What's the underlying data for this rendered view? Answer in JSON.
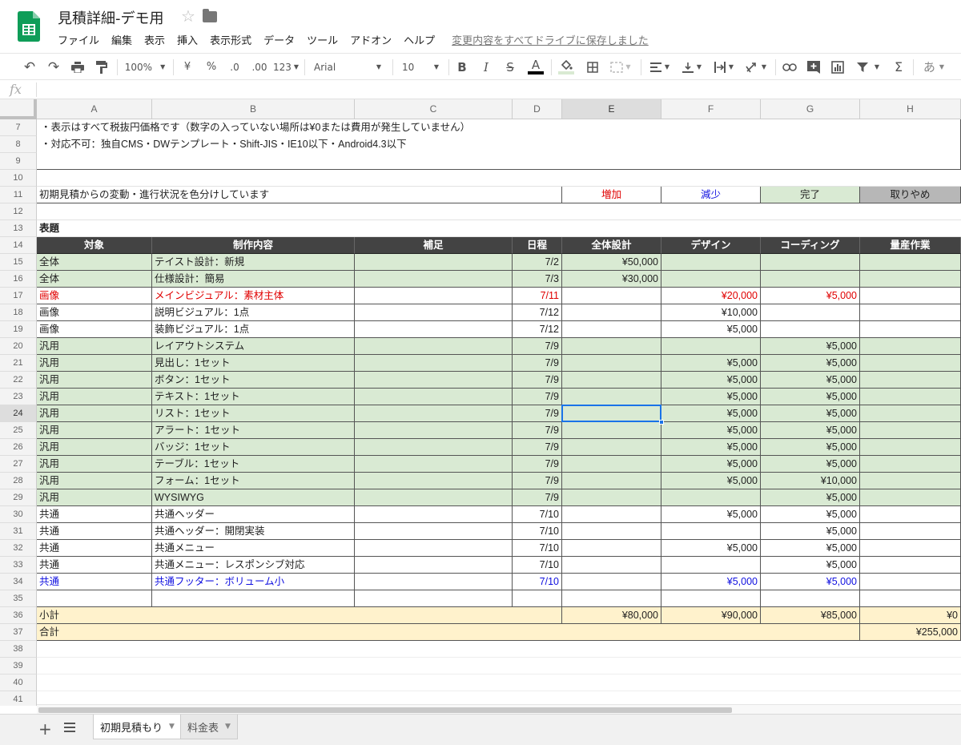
{
  "app": {
    "title": "見積詳細-デモ用",
    "menus": [
      "ファイル",
      "編集",
      "表示",
      "挿入",
      "表示形式",
      "データ",
      "ツール",
      "アドオン",
      "ヘルプ"
    ],
    "save_status": "変更内容をすべてドライブに保存しました"
  },
  "toolbar": {
    "zoom": "100%",
    "currency": "¥",
    "percent": "%",
    "dec_dec": ".0",
    "dec_inc": ".00",
    "format_more": "123",
    "font": "Arial",
    "font_size": "10",
    "bold": "B",
    "italic": "I",
    "strike": "S",
    "text_color": "A",
    "sum": "Σ",
    "input_tool": "あ"
  },
  "formula": {
    "fx": "fx",
    "value": ""
  },
  "columns": [
    "A",
    "B",
    "C",
    "D",
    "E",
    "F",
    "G",
    "H"
  ],
  "selected_col": "E",
  "selected_row": "24",
  "rows": [
    "7",
    "8",
    "9",
    "10",
    "11",
    "12",
    "13",
    "14",
    "15",
    "16",
    "17",
    "18",
    "19",
    "20",
    "21",
    "22",
    "23",
    "24",
    "25",
    "26",
    "27",
    "28",
    "29",
    "30",
    "31",
    "32",
    "33",
    "34",
    "35",
    "36",
    "37",
    "38",
    "39",
    "40",
    "41"
  ],
  "notes": [
    "・表示はすべて税抜円価格です（数字の入っていない場所は¥0または費用が発生していません）",
    "・対応不可：独自CMS・DWテンプレート・Shift-JIS・IE10以下・Android4.3以下"
  ],
  "legend": {
    "label": "初期見積からの変動・進行状況を色分けしています",
    "added": "増加",
    "reduced": "減少",
    "done": "完了",
    "cancelled": "取りやめ"
  },
  "section_title": "表題",
  "table_headers": [
    "対象",
    "制作内容",
    "補足",
    "日程",
    "全体設計",
    "デザイン",
    "コーディング",
    "量産作業"
  ],
  "table_rows": [
    {
      "a": "全体",
      "b": "テイスト設計：新規",
      "c": "",
      "d": "7/2",
      "e": "¥50,000",
      "f": "",
      "g": "",
      "h": "",
      "style": "green"
    },
    {
      "a": "全体",
      "b": "仕様設計：簡易",
      "c": "",
      "d": "7/3",
      "e": "¥30,000",
      "f": "",
      "g": "",
      "h": "",
      "style": "green"
    },
    {
      "a": "画像",
      "b": "メインビジュアル：素材主体",
      "c": "",
      "d": "7/11",
      "e": "",
      "f": "¥20,000",
      "g": "¥5,000",
      "h": "",
      "style": "red"
    },
    {
      "a": "画像",
      "b": "説明ビジュアル：1点",
      "c": "",
      "d": "7/12",
      "e": "",
      "f": "¥10,000",
      "g": "",
      "h": "",
      "style": ""
    },
    {
      "a": "画像",
      "b": "装飾ビジュアル：1点",
      "c": "",
      "d": "7/12",
      "e": "",
      "f": "¥5,000",
      "g": "",
      "h": "",
      "style": ""
    },
    {
      "a": "汎用",
      "b": "レイアウトシステム",
      "c": "",
      "d": "7/9",
      "e": "",
      "f": "",
      "g": "¥5,000",
      "h": "",
      "style": "green"
    },
    {
      "a": "汎用",
      "b": "見出し：1セット",
      "c": "",
      "d": "7/9",
      "e": "",
      "f": "¥5,000",
      "g": "¥5,000",
      "h": "",
      "style": "green"
    },
    {
      "a": "汎用",
      "b": "ボタン：1セット",
      "c": "",
      "d": "7/9",
      "e": "",
      "f": "¥5,000",
      "g": "¥5,000",
      "h": "",
      "style": "green"
    },
    {
      "a": "汎用",
      "b": "テキスト：1セット",
      "c": "",
      "d": "7/9",
      "e": "",
      "f": "¥5,000",
      "g": "¥5,000",
      "h": "",
      "style": "green"
    },
    {
      "a": "汎用",
      "b": "リスト：1セット",
      "c": "",
      "d": "7/9",
      "e": "",
      "f": "¥5,000",
      "g": "¥5,000",
      "h": "",
      "style": "green"
    },
    {
      "a": "汎用",
      "b": "アラート：1セット",
      "c": "",
      "d": "7/9",
      "e": "",
      "f": "¥5,000",
      "g": "¥5,000",
      "h": "",
      "style": "green"
    },
    {
      "a": "汎用",
      "b": "バッジ：1セット",
      "c": "",
      "d": "7/9",
      "e": "",
      "f": "¥5,000",
      "g": "¥5,000",
      "h": "",
      "style": "green"
    },
    {
      "a": "汎用",
      "b": "テーブル：1セット",
      "c": "",
      "d": "7/9",
      "e": "",
      "f": "¥5,000",
      "g": "¥5,000",
      "h": "",
      "style": "green"
    },
    {
      "a": "汎用",
      "b": "フォーム：1セット",
      "c": "",
      "d": "7/9",
      "e": "",
      "f": "¥5,000",
      "g": "¥10,000",
      "h": "",
      "style": "green"
    },
    {
      "a": "汎用",
      "b": "WYSIWYG",
      "c": "",
      "d": "7/9",
      "e": "",
      "f": "",
      "g": "¥5,000",
      "h": "",
      "style": "green"
    },
    {
      "a": "共通",
      "b": "共通ヘッダー",
      "c": "",
      "d": "7/10",
      "e": "",
      "f": "¥5,000",
      "g": "¥5,000",
      "h": "",
      "style": ""
    },
    {
      "a": "共通",
      "b": "共通ヘッダー：開閉実装",
      "c": "",
      "d": "7/10",
      "e": "",
      "f": "",
      "g": "¥5,000",
      "h": "",
      "style": ""
    },
    {
      "a": "共通",
      "b": "共通メニュー",
      "c": "",
      "d": "7/10",
      "e": "",
      "f": "¥5,000",
      "g": "¥5,000",
      "h": "",
      "style": ""
    },
    {
      "a": "共通",
      "b": "共通メニュー：レスポンシブ対応",
      "c": "",
      "d": "7/10",
      "e": "",
      "f": "",
      "g": "¥5,000",
      "h": "",
      "style": ""
    },
    {
      "a": "共通",
      "b": "共通フッター：ボリューム小",
      "c": "",
      "d": "7/10",
      "e": "",
      "f": "¥5,000",
      "g": "¥5,000",
      "h": "",
      "style": "blue"
    },
    {
      "a": "",
      "b": "",
      "c": "",
      "d": "",
      "e": "",
      "f": "",
      "g": "",
      "h": "",
      "style": ""
    }
  ],
  "subtotal": {
    "label": "小計",
    "e": "¥80,000",
    "f": "¥90,000",
    "g": "¥85,000",
    "h": "¥0"
  },
  "total": {
    "label": "合計",
    "h": "¥255,000"
  },
  "sheets": [
    {
      "name": "初期見積もり",
      "active": true
    },
    {
      "name": "料金表",
      "active": false
    }
  ],
  "colors": {
    "green_fill": "#d9ead3",
    "yellow_fill": "#fff2cc",
    "header_fill": "#434343",
    "cancel_fill": "#b7b7b7",
    "added_text": "#e00000",
    "reduced_text": "#1010e0",
    "selection": "#1a73e8",
    "sheets_green": "#0f9d58"
  }
}
